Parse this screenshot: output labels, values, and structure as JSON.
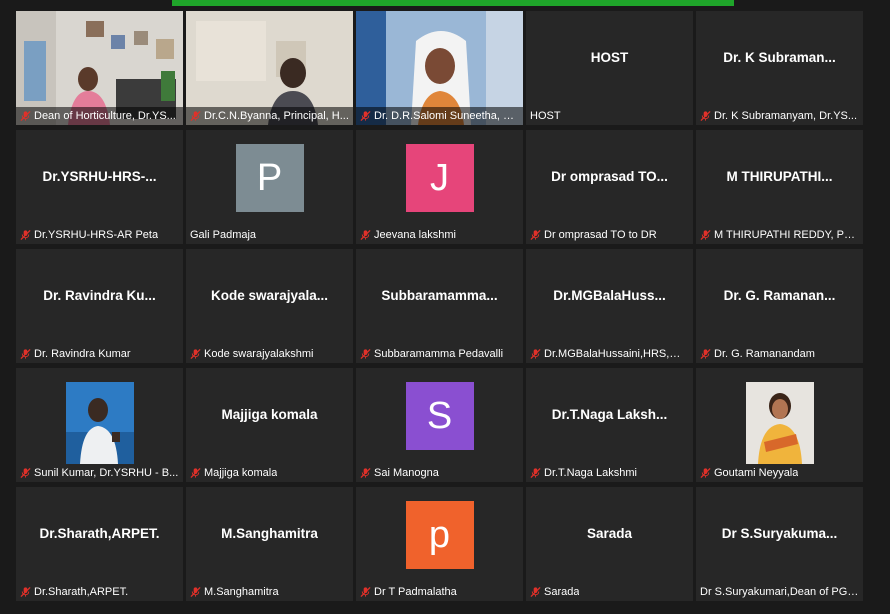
{
  "tiles": [
    {
      "kind": "video",
      "name": "Dean of Horticulture, Dr.YS...",
      "muted": true
    },
    {
      "kind": "video",
      "name": "Dr.C.N.Byanna, Principal, H...",
      "muted": true
    },
    {
      "kind": "video",
      "name": "Dr. D.R.Salomi Suneetha, D...",
      "muted": true
    },
    {
      "kind": "name",
      "center": "HOST",
      "name": "HOST",
      "muted": false
    },
    {
      "kind": "name",
      "center": "Dr. K Subraman...",
      "name": "Dr. K Subramanyam, Dr.YS...",
      "muted": true
    },
    {
      "kind": "name",
      "center": "Dr.YSRHU-HRS-...",
      "name": "Dr.YSRHU-HRS-AR Peta",
      "muted": true
    },
    {
      "kind": "avatar",
      "letter": "P",
      "color": "#7d8c93",
      "name": "Gali Padmaja",
      "muted": false
    },
    {
      "kind": "avatar",
      "letter": "J",
      "color": "#e6457a",
      "name": "Jeevana lakshmi",
      "muted": true
    },
    {
      "kind": "name",
      "center": "Dr omprasad TO...",
      "name": "Dr omprasad TO to DR",
      "muted": true
    },
    {
      "kind": "name",
      "center": "M THIRUPATHI...",
      "name": "M THIRUPATHI REDDY, PS ...",
      "muted": true
    },
    {
      "kind": "name",
      "center": "Dr. Ravindra Ku...",
      "name": "Dr. Ravindra Kumar",
      "muted": true
    },
    {
      "kind": "name",
      "center": "Kode swarajyala...",
      "name": "Kode swarajyalakshmi",
      "muted": true
    },
    {
      "kind": "name",
      "center": "Subbaramamma...",
      "name": "Subbaramamma Pedavalli",
      "muted": true
    },
    {
      "kind": "name",
      "center": "Dr.MGBalaHuss...",
      "name": "Dr.MGBalaHussaini,HRS,MPL",
      "muted": true
    },
    {
      "kind": "name",
      "center": "Dr. G. Ramanan...",
      "name": "Dr. G. Ramanandam",
      "muted": true
    },
    {
      "kind": "photo",
      "photo": "man",
      "name": "Sunil Kumar,  Dr.YSRHU - B...",
      "muted": true
    },
    {
      "kind": "name",
      "center": "Majjiga komala",
      "name": "Majjiga komala",
      "muted": true
    },
    {
      "kind": "avatar",
      "letter": "S",
      "color": "#8a4fd1",
      "name": "Sai Manogna",
      "muted": true
    },
    {
      "kind": "name",
      "center": "Dr.T.Naga Laksh...",
      "name": "Dr.T.Naga Lakshmi",
      "muted": true
    },
    {
      "kind": "photo",
      "photo": "woman",
      "name": "Goutami Neyyala",
      "muted": true
    },
    {
      "kind": "name",
      "center": "Dr.Sharath,ARPET.",
      "name": "Dr.Sharath,ARPET.",
      "muted": true
    },
    {
      "kind": "name",
      "center": "M.Sanghamitra",
      "name": "M.Sanghamitra",
      "muted": true
    },
    {
      "kind": "avatar",
      "letter": "p",
      "color": "#f0622c",
      "name": "Dr T Padmalatha",
      "muted": true
    },
    {
      "kind": "name",
      "center": "Sarada",
      "name": "Sarada",
      "muted": true
    },
    {
      "kind": "name",
      "center": "Dr  S.Suryakuma...",
      "name": "Dr S.Suryakumari,Dean of PG ...",
      "muted": false
    }
  ],
  "colors": {
    "muted_icon": "#e0312a",
    "topbar": "#1fa52a"
  }
}
